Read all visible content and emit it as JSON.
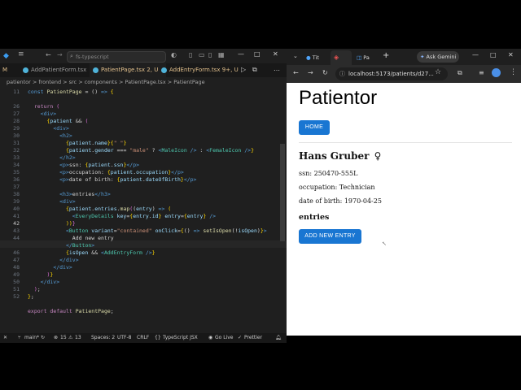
{
  "vscode": {
    "search_placeholder": "fs-typescript",
    "tabs": [
      {
        "label": "AddPatientForm.tsx"
      },
      {
        "label": "PatientPage.tsx 2, U"
      },
      {
        "label": "AddEntryForm.tsx 9+, U"
      }
    ],
    "tab_marker": "M",
    "breadcrumb": "patientor > frontend > src > components > PatientPage.tsx > PatientPage",
    "line_numbers": [
      "11",
      "26",
      "27",
      "28",
      "29",
      "30",
      "31",
      "32",
      "33",
      "34",
      "35",
      "36",
      "37",
      "38",
      "39",
      "40",
      "41",
      "42",
      "43",
      "44",
      "45",
      "46",
      "47",
      "48",
      "49",
      "50",
      "51",
      "52"
    ],
    "status": {
      "branch": "main*",
      "problems": "15",
      "warnings": "13",
      "spaces": "Spaces: 2",
      "encoding": "UTF-8",
      "eol": "CRLF",
      "language": "TypeScript JSX",
      "golive": "Go Live",
      "prettier": "Prettier"
    }
  },
  "chrome": {
    "tabs": [
      {
        "label": "Tit"
      },
      {
        "label": "Pa"
      }
    ],
    "ask": "Ask Gemini",
    "url": "localhost:5173/patients/d27...",
    "page": {
      "app_title": "Patientor",
      "home_button": "HOME",
      "patient_name": "Hans Gruber",
      "gender_symbol": "♀",
      "ssn": "ssn: 250470-555L",
      "occupation": "occupation: Technician",
      "dob": "date of birth: 1970-04-25",
      "entries_heading": "entries",
      "add_entry_button": "ADD NEW ENTRY"
    }
  }
}
